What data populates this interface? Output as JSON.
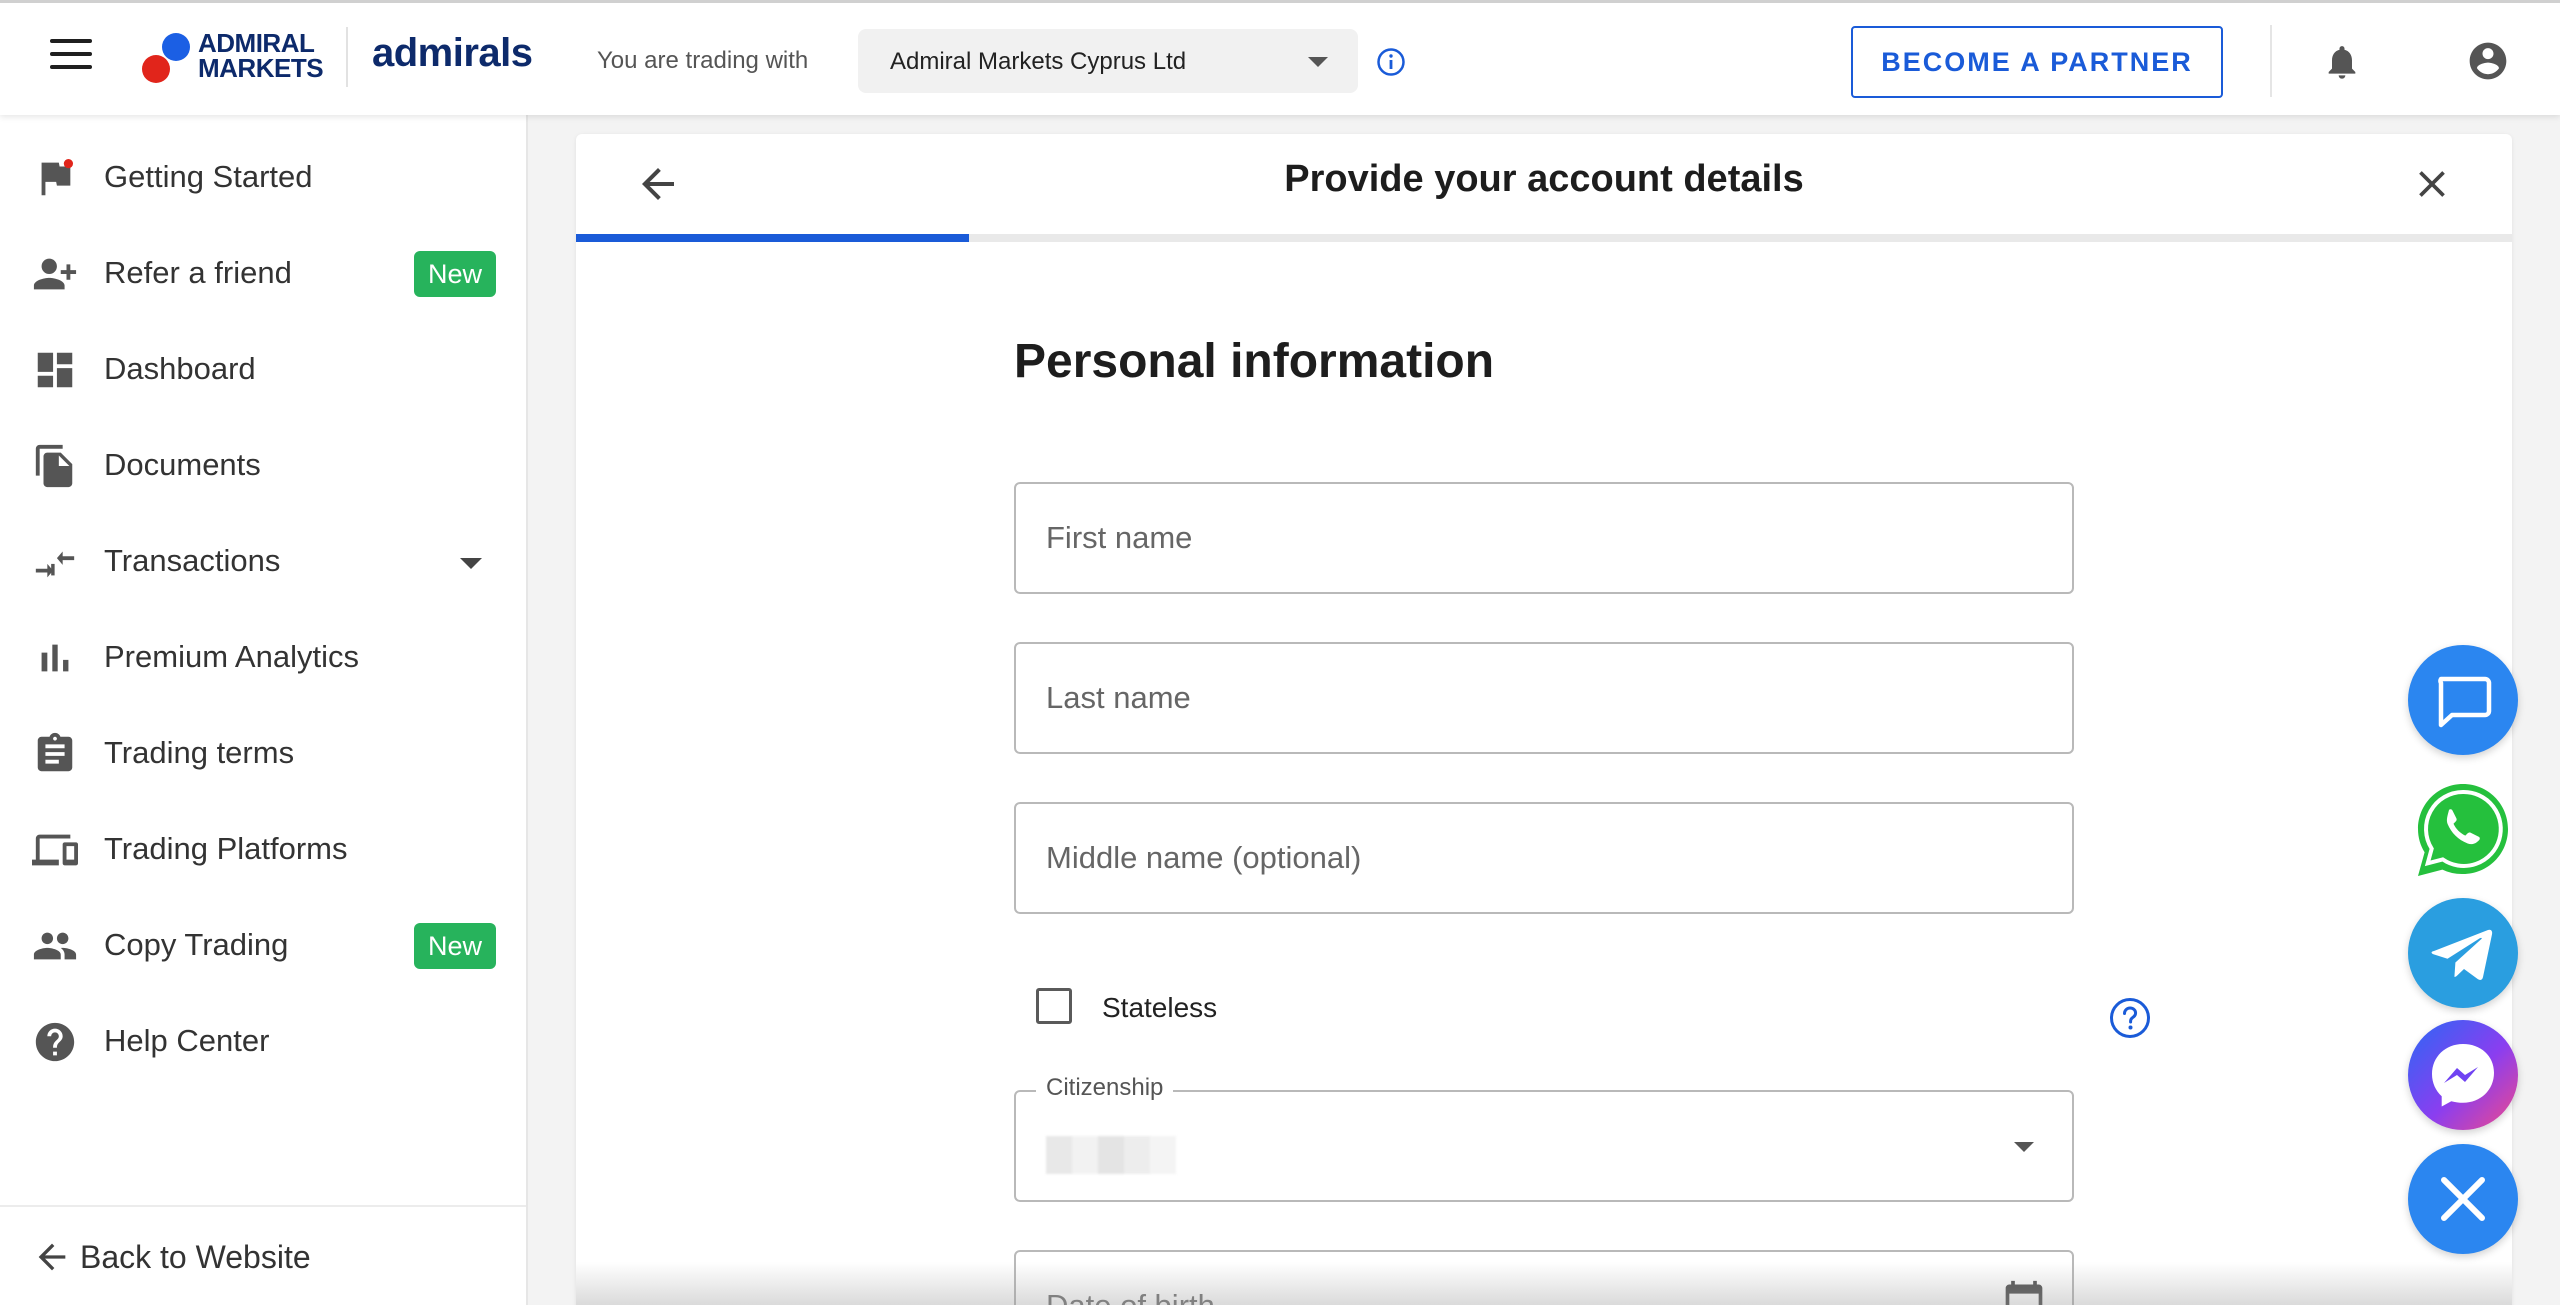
{
  "header": {
    "logo_am_line1": "ADMIRAL",
    "logo_am_line2": "MARKETS",
    "logo_admirals": "admirals",
    "trading_with_label": "You are trading with",
    "entity_selected": "Admiral Markets Cyprus Ltd",
    "partner_button": "BECOME A PARTNER"
  },
  "sidebar": {
    "items": [
      {
        "label": "Getting Started",
        "icon": "flag-icon"
      },
      {
        "label": "Refer a friend",
        "icon": "person-add-icon",
        "badge": "New"
      },
      {
        "label": "Dashboard",
        "icon": "dashboard-icon"
      },
      {
        "label": "Documents",
        "icon": "documents-icon"
      },
      {
        "label": "Transactions",
        "icon": "transfer-arrows-icon"
      },
      {
        "label": "Premium Analytics",
        "icon": "bar-chart-icon"
      },
      {
        "label": "Trading terms",
        "icon": "clipboard-icon"
      },
      {
        "label": "Trading Platforms",
        "icon": "devices-icon"
      },
      {
        "label": "Copy Trading",
        "icon": "people-icon",
        "badge": "New"
      },
      {
        "label": "Help Center",
        "icon": "help-circle-icon"
      }
    ],
    "back_to_website": "Back to Website"
  },
  "form": {
    "title": "Provide your account details",
    "progress_fraction": 0.203,
    "section_title": "Personal information",
    "first_name_placeholder": "First name",
    "last_name_placeholder": "Last name",
    "middle_name_placeholder": "Middle name (optional)",
    "stateless_label": "Stateless",
    "citizenship_label": "Citizenship",
    "dob_placeholder": "Date of birth"
  },
  "colors": {
    "brand_blue": "#1a5bd8",
    "badge_green": "#27b35c",
    "chat_blue": "#2b86f0",
    "whatsapp_green": "#25c03d",
    "telegram_blue": "#2a9ee0"
  }
}
